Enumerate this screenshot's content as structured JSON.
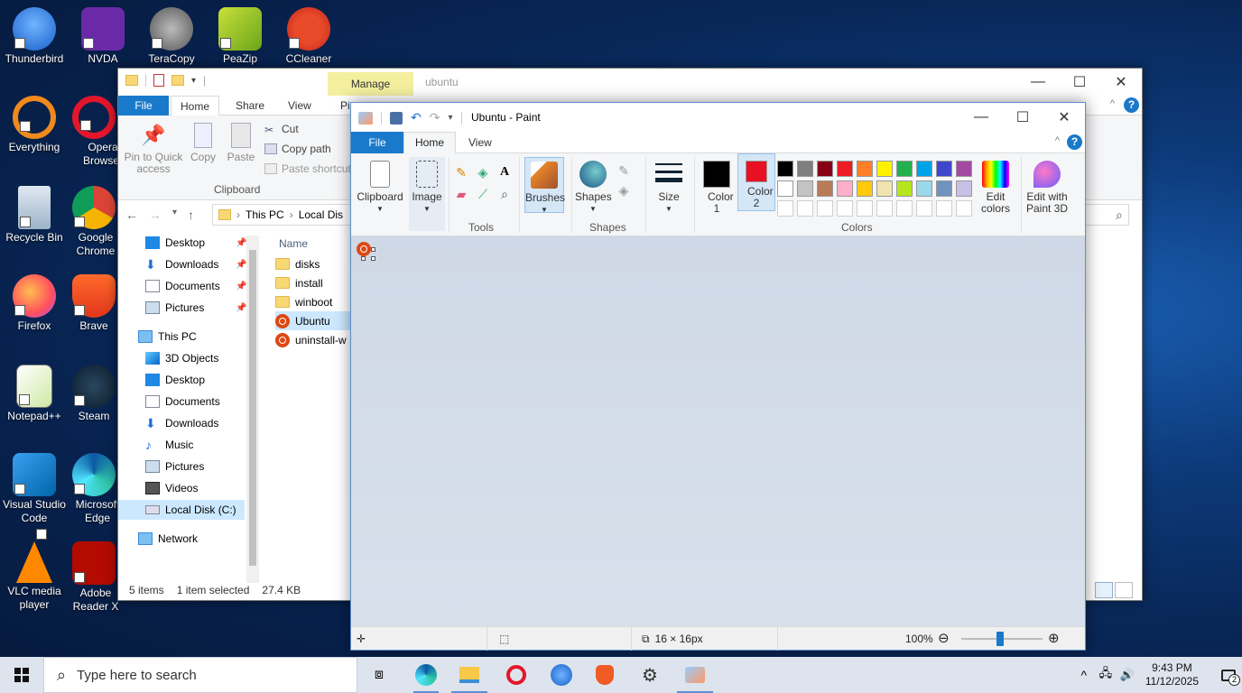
{
  "desktop": {
    "icons": [
      {
        "label": "Thunderbird"
      },
      {
        "label": "NVDA"
      },
      {
        "label": "TeraCopy"
      },
      {
        "label": "PeaZip"
      },
      {
        "label": "CCleaner"
      },
      {
        "label": "Everything"
      },
      {
        "label": "Opera Browser"
      },
      {
        "label": "Recycle Bin"
      },
      {
        "label": "Google Chrome"
      },
      {
        "label": "Firefox"
      },
      {
        "label": "Brave"
      },
      {
        "label": "Notepad++"
      },
      {
        "label": "Steam"
      },
      {
        "label": "Visual Studio Code"
      },
      {
        "label": "Microsoft Edge"
      },
      {
        "label": "VLC media player"
      },
      {
        "label": "Adobe Reader X"
      }
    ]
  },
  "explorer": {
    "manage_label": "Manage",
    "window_title": "ubuntu",
    "tabs": {
      "file": "File",
      "home": "Home",
      "share": "Share",
      "view": "View",
      "picture": "Pic"
    },
    "ribbon": {
      "pin_label": "Pin to Quick access",
      "copy_label": "Copy",
      "paste_label": "Paste",
      "cut_label": "Cut",
      "copy_path_label": "Copy path",
      "paste_shortcut_label": "Paste shortcut",
      "group_clipboard": "Clipboard"
    },
    "address": {
      "this_pc": "This PC",
      "local_disk": "Local Dis"
    },
    "nav": {
      "quick": [
        "Desktop",
        "Downloads",
        "Documents",
        "Pictures"
      ],
      "this_pc": "This PC",
      "pc_items": [
        "3D Objects",
        "Desktop",
        "Documents",
        "Downloads",
        "Music",
        "Pictures",
        "Videos",
        "Local Disk (C:)"
      ],
      "network": "Network"
    },
    "columns": {
      "name": "Name"
    },
    "files": [
      "disks",
      "install",
      "winboot",
      "Ubuntu",
      "uninstall-w"
    ],
    "status": {
      "items": "5 items",
      "selected": "1 item selected",
      "size": "27.4 KB"
    }
  },
  "paint": {
    "title": "Ubuntu - Paint",
    "tabs": {
      "file": "File",
      "home": "Home",
      "view": "View"
    },
    "ribbon": {
      "clipboard": "Clipboard",
      "image": "Image",
      "tools_group": "Tools",
      "brushes": "Brushes",
      "shapes": "Shapes",
      "shapes_group": "Shapes",
      "size": "Size",
      "color1": "Color 1",
      "color2": "Color 2",
      "edit_colors": "Edit colors",
      "edit_paint3d": "Edit with Paint 3D",
      "colors_group": "Colors"
    },
    "color1_value": "#000000",
    "color2_value": "#e81123",
    "palette_row1": [
      "#000000",
      "#7f7f7f",
      "#880015",
      "#ed1c24",
      "#ff7f27",
      "#fff200",
      "#22b14c",
      "#00a2e8",
      "#3f48cc",
      "#a349a4"
    ],
    "palette_row2": [
      "#ffffff",
      "#c3c3c3",
      "#b97a57",
      "#ffaec9",
      "#ffc90e",
      "#efe4b0",
      "#b5e61d",
      "#99d9ea",
      "#7092be",
      "#c8bfe7"
    ],
    "status": {
      "image_size": "16 × 16px",
      "zoom": "100%"
    }
  },
  "taskbar": {
    "search_placeholder": "Type here to search",
    "time": "9:43 PM",
    "date": "11/12/2025",
    "notification_count": "2"
  }
}
